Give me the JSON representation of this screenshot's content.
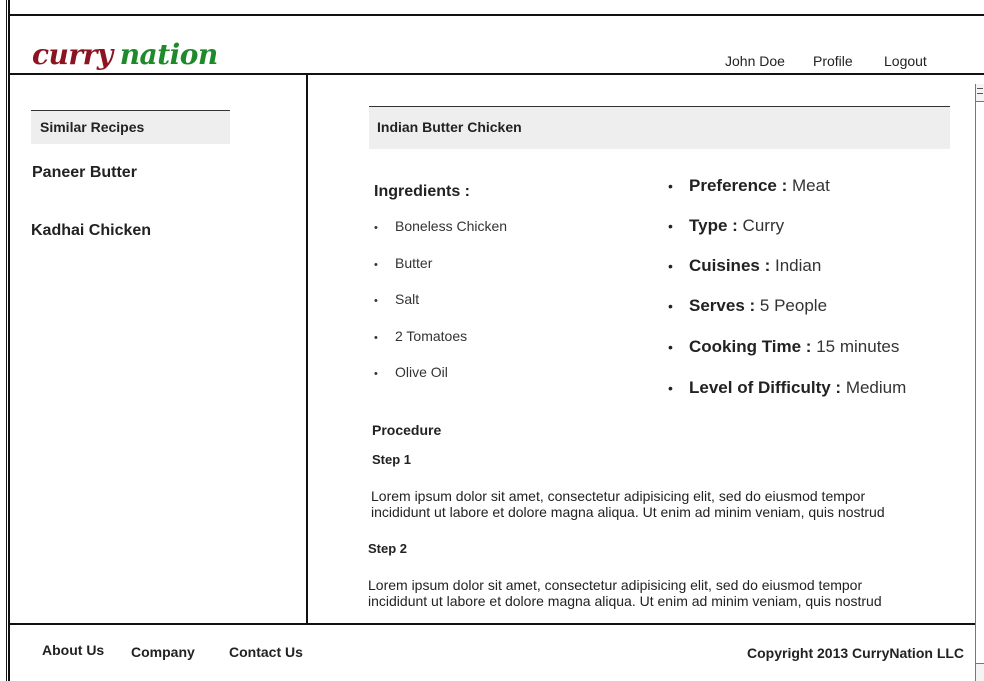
{
  "brand": {
    "logo_part1": "curry",
    "logo_part2": "nation"
  },
  "nav": {
    "user": "John Doe",
    "profile": "Profile",
    "logout": "Logout"
  },
  "sidebar": {
    "heading": "Similar Recipes",
    "items": [
      {
        "label": "Paneer Butter"
      },
      {
        "label": "Kadhai Chicken"
      }
    ]
  },
  "recipe": {
    "title": "Indian Butter Chicken",
    "ingredients_heading": "Ingredients :",
    "ingredients": [
      "Boneless Chicken",
      "Butter",
      "Salt",
      "2 Tomatoes",
      "Olive Oil"
    ],
    "info": [
      {
        "key": "Preference :",
        "value": "Meat"
      },
      {
        "key": "Type :",
        "value": "Curry"
      },
      {
        "key": "Cuisines :",
        "value": "Indian"
      },
      {
        "key": "Serves :",
        "value": "5 People"
      },
      {
        "key": "Cooking Time :",
        "value": "15 minutes"
      },
      {
        "key": "Level of Difficulty :",
        "value": "Medium"
      }
    ],
    "procedure_heading": "Procedure",
    "steps": [
      {
        "title": "Step 1",
        "line1": "Lorem ipsum dolor sit amet, consectetur adipisicing elit, sed do eiusmod tempor",
        "line2": "incididunt ut labore et dolore magna aliqua. Ut enim ad minim veniam, quis nostrud"
      },
      {
        "title": "Step 2",
        "line1": "Lorem ipsum dolor sit amet, consectetur adipisicing elit, sed do eiusmod tempor",
        "line2": "incididunt ut labore et dolore magna aliqua. Ut enim ad minim veniam, quis nostrud"
      }
    ]
  },
  "footer": {
    "about": "About Us",
    "company": "Company",
    "contact": "Contact Us",
    "copyright": "Copyright 2013 CurryNation LLC"
  },
  "colors": {
    "logo_red": "#8b1420",
    "logo_green": "#1f8a2b",
    "panel_gray": "#eeeeee"
  }
}
